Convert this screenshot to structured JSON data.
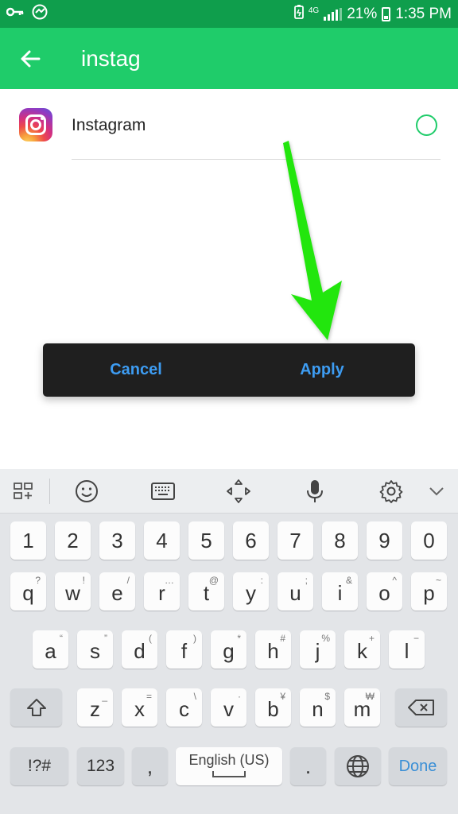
{
  "status_bar": {
    "network": "4G",
    "battery": "21%",
    "time": "1:35 PM"
  },
  "app_bar": {
    "search_query": "instag"
  },
  "results": [
    {
      "name": "Instagram",
      "selected": false
    }
  ],
  "actions": {
    "cancel": "Cancel",
    "apply": "Apply"
  },
  "keyboard": {
    "toolbar": [
      "apps-icon",
      "emoji-icon",
      "keyboard-icon",
      "cursor-move-icon",
      "mic-icon",
      "settings-icon",
      "chevron-down-icon"
    ],
    "row_numbers": [
      "1",
      "2",
      "3",
      "4",
      "5",
      "6",
      "7",
      "8",
      "9",
      "0"
    ],
    "row1": [
      {
        "k": "q",
        "h": "?"
      },
      {
        "k": "w",
        "h": "!"
      },
      {
        "k": "e",
        "h": "/"
      },
      {
        "k": "r",
        "h": "…"
      },
      {
        "k": "t",
        "h": "@"
      },
      {
        "k": "y",
        "h": ":"
      },
      {
        "k": "u",
        "h": ";"
      },
      {
        "k": "i",
        "h": "&"
      },
      {
        "k": "o",
        "h": "^"
      },
      {
        "k": "p",
        "h": "~"
      }
    ],
    "row2": [
      {
        "k": "a",
        "h": "“"
      },
      {
        "k": "s",
        "h": "”"
      },
      {
        "k": "d",
        "h": "("
      },
      {
        "k": "f",
        "h": ")"
      },
      {
        "k": "g",
        "h": "*"
      },
      {
        "k": "h",
        "h": "#"
      },
      {
        "k": "j",
        "h": "%"
      },
      {
        "k": "k",
        "h": "+"
      },
      {
        "k": "l",
        "h": "−"
      }
    ],
    "row3": [
      {
        "k": "z",
        "h": "_"
      },
      {
        "k": "x",
        "h": "="
      },
      {
        "k": "c",
        "h": "\\"
      },
      {
        "k": "v",
        "h": "·"
      },
      {
        "k": "b",
        "h": "¥"
      },
      {
        "k": "n",
        "h": "$"
      },
      {
        "k": "m",
        "h": "₩"
      }
    ],
    "symbols_label": "!?#",
    "numbers_label": "123",
    "comma_label": ",",
    "space_label": "English (US)",
    "period_label": ".",
    "done_label": "Done"
  },
  "colors": {
    "status_bar": "#0f9e4c",
    "app_bar": "#1fcc6a",
    "accent_text": "#3d9cf2",
    "arrow": "#22e60b"
  }
}
